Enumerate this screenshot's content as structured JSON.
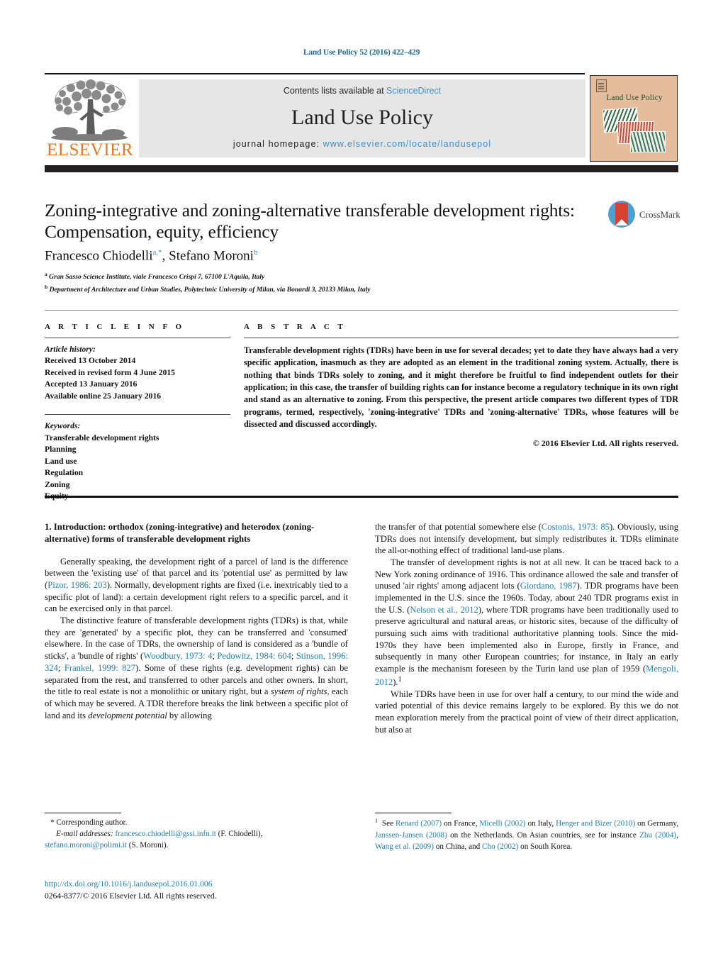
{
  "running_head": "Land Use Policy 52 (2016) 422–429",
  "masthead": {
    "publisher_logo_text": "ELSEVIER",
    "contents_prefix": "Contents lists available at ",
    "contents_link": "ScienceDirect",
    "journal_name": "Land Use Policy",
    "homepage_prefix": "journal homepage: ",
    "homepage_url": "www.elsevier.com/locate/landusepol",
    "cover_title": "Land Use Policy"
  },
  "article": {
    "title": "Zoning-integrative and zoning-alternative transferable development rights: Compensation, equity, efficiency",
    "authors_html": "Francesco Chiodelli<sup>a,*</sup>, Stefano Moroni<sup>b</sup>",
    "affiliation_a": "Gran Sasso Science Institute, viale Francesco Crispi 7, 67100 L'Aquila, Italy",
    "affiliation_b": "Department of Architecture and Urban Studies, Polytechnic University of Milan, via Bonardi 3, 20133 Milan, Italy",
    "crossmark_label": "CrossMark"
  },
  "info": {
    "heading": "A R T I C L E   I N F O",
    "history_label": "Article history:",
    "history": [
      "Received 13 October 2014",
      "Received in revised form 4 June 2015",
      "Accepted 13 January 2016",
      "Available online 25 January 2016"
    ],
    "keywords_label": "Keywords:",
    "keywords": [
      "Transferable development rights",
      "Planning",
      "Land use",
      "Regulation",
      "Zoning",
      "Equity"
    ]
  },
  "abstract": {
    "heading": "A B S T R A C T",
    "text": "Transferable development rights (TDRs) have been in use for several decades; yet to date they have always had a very specific application, inasmuch as they are adopted as an element in the traditional zoning system. Actually, there is nothing that binds TDRs solely to zoning, and it might therefore be fruitful to find independent outlets for their application; in this case, the transfer of building rights can for instance become a regulatory technique in its own right and stand as an alternative to zoning. From this perspective, the present article compares two different types of TDR programs, termed, respectively, 'zoning-integrative' TDRs and 'zoning-alternative' TDRs, whose features will be dissected and discussed accordingly.",
    "copyright": "© 2016 Elsevier Ltd. All rights reserved."
  },
  "body": {
    "section_heading": "1.  Introduction: orthodox (zoning-integrative) and heterodox (zoning-alternative) forms of transferable development rights",
    "left_paragraphs": [
      "Generally speaking, the development right of a parcel of land is the difference between the 'existing use' of that parcel and its 'potential use' as permitted by law (Pizor, 1986: 203). Normally, development rights are fixed (i.e. inextricably tied to a specific plot of land): a certain development right refers to a specific parcel, and it can be exercised only in that parcel.",
      "The distinctive feature of transferable development rights (TDRs) is that, while they are 'generated' by a specific plot, they can be transferred and 'consumed' elsewhere. In the case of TDRs, the ownership of land is considered as a 'bundle of sticks', a 'bundle of rights' (Woodbury, 1973: 4; Pedowitz, 1984: 604; Stinson, 1996: 324; Frankel, 1999: 827). Some of these rights (e.g. development rights) can be separated from the rest, and transferred to other parcels and other owners. In short, the title to real estate is not a monolithic or unitary right, but a system of rights, each of which may be severed. A TDR therefore breaks the link between a specific plot of land and its development potential by allowing"
    ],
    "right_paragraphs": [
      "the transfer of that potential somewhere else (Costonis, 1973: 85). Obviously, using TDRs does not intensify development, but simply redistributes it. TDRs eliminate the all-or-nothing effect of traditional land-use plans.",
      "The transfer of development rights is not at all new. It can be traced back to a New York zoning ordinance of 1916. This ordinance allowed the sale and transfer of unused 'air rights' among adjacent lots (Giordano, 1987). TDR programs have been implemented in the U.S. since the 1960s. Today, about 240 TDR programs exist in the U.S. (Nelson et al., 2012), where TDR programs have been traditionally used to preserve agricultural and natural areas, or historic sites, because of the difficulty of pursuing such aims with traditional authoritative planning tools. Since the mid-1970s they have been implemented also in Europe, firstly in France, and subsequently in many other European countries; for instance, in Italy an early example is the mechanism foreseen by the Turin land use plan of 1959 (Mengoli, 2012).",
      "While TDRs have been in use for over half a century, to our mind the wide and varied potential of this device remains largely to be explored. By this we do not mean exploration merely from the practical point of view of their direct application, but also at"
    ]
  },
  "footnotes": {
    "corresponding_author": "* Corresponding author.",
    "email_label": "E-mail addresses:",
    "email_1": "francesco.chiodelli@gssi.infn.it",
    "email_1_name": "(F. Chiodelli),",
    "email_2": "stefano.moroni@polimi.it",
    "email_2_name": "(S. Moroni).",
    "doi": "http://dx.doi.org/10.1016/j.landusepol.2016.01.006",
    "issn_line": "0264-8377/© 2016 Elsevier Ltd. All rights reserved.",
    "note_1": "See Renard (2007) on France, Micelli (2002) on Italy, Henger and Bizer (2010) on Germany, Janssen-Jansen (2008) on the Netherlands. On Asian countries, see for instance Zhu (2004), Wang et al. (2009) on China, and Cho (2002) on South Korea."
  },
  "colors": {
    "link": "#1f7fb0",
    "elsevier_orange": "#e87722",
    "sciencedirect_blue": "#3e8ec6",
    "band_dark": "#231f20",
    "cover_bg": "#e6bd9c"
  }
}
